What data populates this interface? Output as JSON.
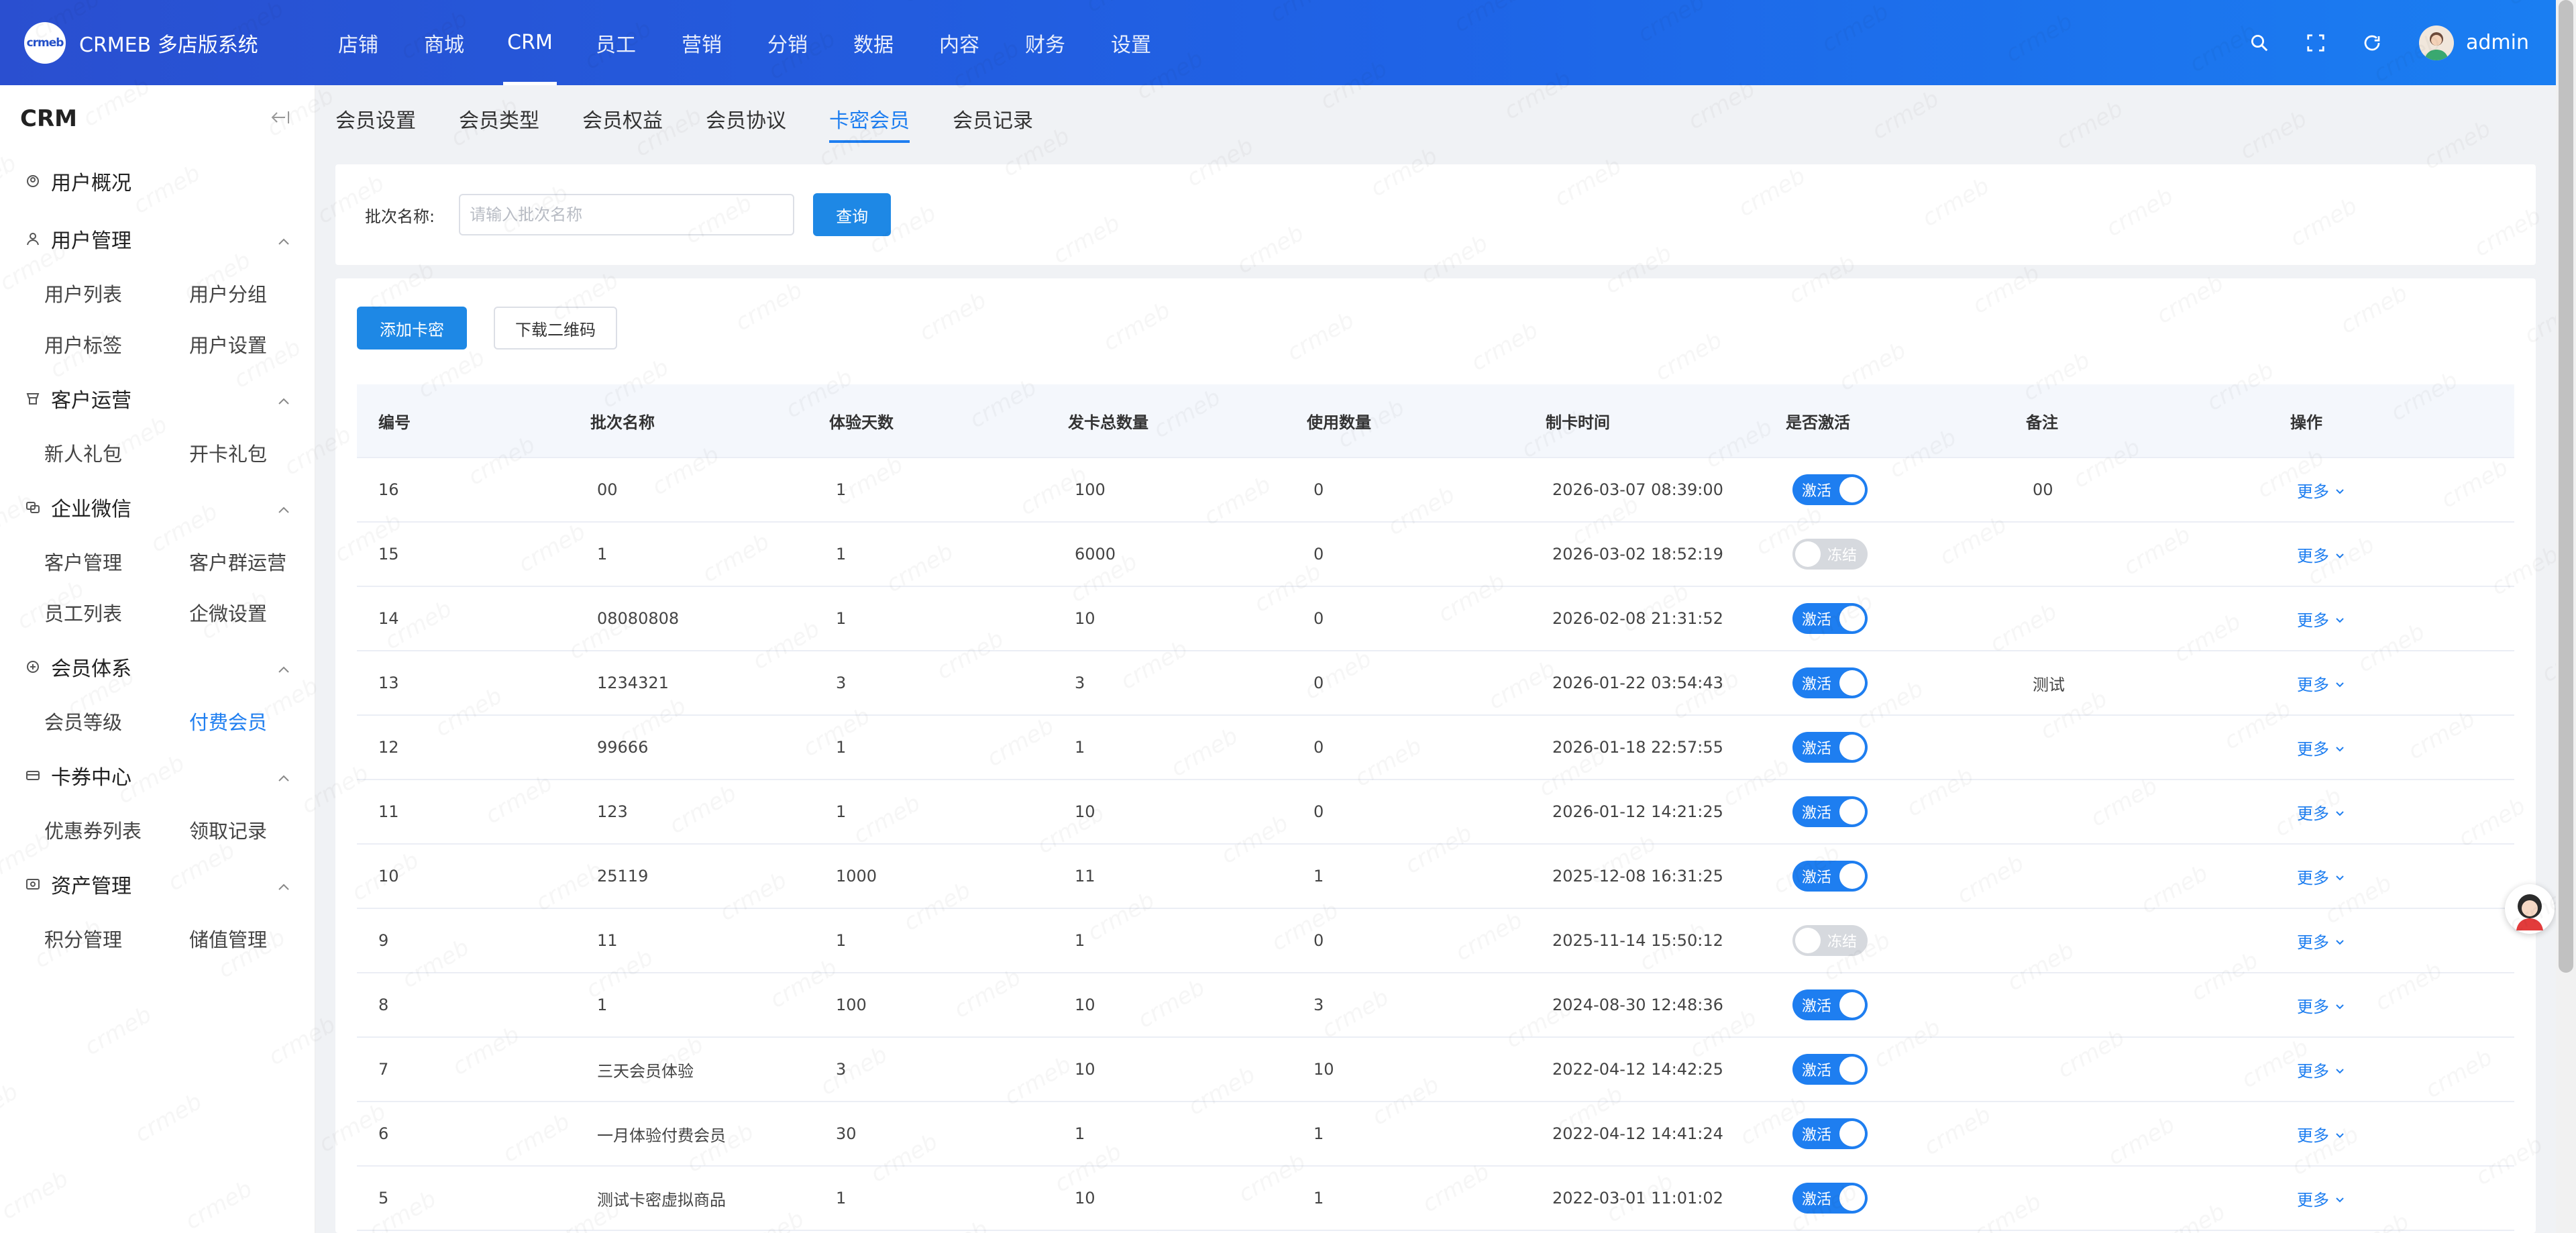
{
  "app": {
    "logo_text": "crmeb",
    "title": "CRMEB 多店版系统"
  },
  "topnav": [
    {
      "label": "店铺"
    },
    {
      "label": "商城"
    },
    {
      "label": "CRM"
    },
    {
      "label": "员工"
    },
    {
      "label": "营销"
    },
    {
      "label": "分销"
    },
    {
      "label": "数据"
    },
    {
      "label": "内容"
    },
    {
      "label": "财务"
    },
    {
      "label": "设置"
    }
  ],
  "topnav_active": "CRM",
  "user": {
    "name": "admin"
  },
  "sidebar": {
    "title": "CRM",
    "sections": [
      {
        "label": "用户概况",
        "icon": "user-overview-icon",
        "items": []
      },
      {
        "label": "用户管理",
        "icon": "user-manage-icon",
        "items": [
          "用户列表",
          "用户分组",
          "用户标签",
          "用户设置"
        ]
      },
      {
        "label": "客户运营",
        "icon": "customer-ops-icon",
        "items": [
          "新人礼包",
          "开卡礼包"
        ]
      },
      {
        "label": "企业微信",
        "icon": "wecom-icon",
        "items": [
          "客户管理",
          "客户群运营",
          "员工列表",
          "企微设置"
        ]
      },
      {
        "label": "会员体系",
        "icon": "member-icon",
        "items": [
          "会员等级",
          "付费会员"
        ]
      },
      {
        "label": "卡券中心",
        "icon": "coupon-icon",
        "items": [
          "优惠券列表",
          "领取记录"
        ]
      },
      {
        "label": "资产管理",
        "icon": "asset-icon",
        "items": [
          "积分管理",
          "储值管理"
        ]
      }
    ],
    "active_item": "付费会员"
  },
  "tabs": [
    {
      "label": "会员设置"
    },
    {
      "label": "会员类型"
    },
    {
      "label": "会员权益"
    },
    {
      "label": "会员协议"
    },
    {
      "label": "卡密会员"
    },
    {
      "label": "会员记录"
    }
  ],
  "tab_active": "卡密会员",
  "filter": {
    "label": "批次名称:",
    "placeholder": "请输入批次名称",
    "value": "",
    "search_button": "查询"
  },
  "actions": {
    "add_button": "添加卡密",
    "download_button": "下载二维码"
  },
  "table": {
    "headers": [
      "编号",
      "批次名称",
      "体验天数",
      "发卡总数量",
      "使用数量",
      "制卡时间",
      "是否激活",
      "备注",
      "操作"
    ],
    "rows": [
      {
        "id": "16",
        "name": "00",
        "days": "1",
        "total": "100",
        "used": "0",
        "time": "2026-03-07 08:39:00",
        "active": true,
        "note": "00"
      },
      {
        "id": "15",
        "name": "1",
        "days": "1",
        "total": "6000",
        "used": "0",
        "time": "2026-03-02 18:52:19",
        "active": false,
        "note": ""
      },
      {
        "id": "14",
        "name": "08080808",
        "days": "1",
        "total": "10",
        "used": "0",
        "time": "2026-02-08 21:31:52",
        "active": true,
        "note": ""
      },
      {
        "id": "13",
        "name": "1234321",
        "days": "3",
        "total": "3",
        "used": "0",
        "time": "2026-01-22 03:54:43",
        "active": true,
        "note": "测试"
      },
      {
        "id": "12",
        "name": "99666",
        "days": "1",
        "total": "1",
        "used": "0",
        "time": "2026-01-18 22:57:55",
        "active": true,
        "note": ""
      },
      {
        "id": "11",
        "name": "123",
        "days": "1",
        "total": "10",
        "used": "0",
        "time": "2026-01-12 14:21:25",
        "active": true,
        "note": ""
      },
      {
        "id": "10",
        "name": "25119",
        "days": "1000",
        "total": "11",
        "used": "1",
        "time": "2025-12-08 16:31:25",
        "active": true,
        "note": ""
      },
      {
        "id": "9",
        "name": "11",
        "days": "1",
        "total": "1",
        "used": "0",
        "time": "2025-11-14 15:50:12",
        "active": false,
        "note": ""
      },
      {
        "id": "8",
        "name": "1",
        "days": "100",
        "total": "10",
        "used": "3",
        "time": "2024-08-30 12:48:36",
        "active": true,
        "note": ""
      },
      {
        "id": "7",
        "name": "三天会员体验",
        "days": "3",
        "total": "10",
        "used": "10",
        "time": "2022-04-12 14:42:25",
        "active": true,
        "note": ""
      },
      {
        "id": "6",
        "name": "一月体验付费会员",
        "days": "30",
        "total": "1",
        "used": "1",
        "time": "2022-04-12 14:41:24",
        "active": true,
        "note": ""
      },
      {
        "id": "5",
        "name": "测试卡密虚拟商品",
        "days": "1",
        "total": "10",
        "used": "1",
        "time": "2022-03-01 11:01:02",
        "active": true,
        "note": ""
      }
    ],
    "toggle_on_label": "激活",
    "toggle_off_label": "冻结",
    "more_label": "更多"
  },
  "colors": {
    "accent": "#1e7ef0",
    "header_start": "#2a4fd0",
    "header_end": "#1a7ef2"
  }
}
